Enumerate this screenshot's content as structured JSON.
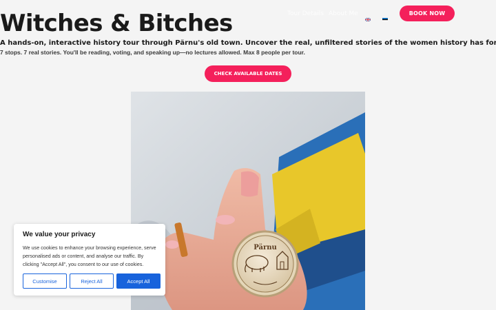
{
  "header": {
    "nav": [
      {
        "label": "Tour Details"
      },
      {
        "label": "About Me"
      }
    ],
    "languages": [
      "English",
      "Eesti"
    ],
    "book_label": "BOOK NOW"
  },
  "hero": {
    "title": "Witches & Bitches",
    "subtitle": "A hands-on, interactive history tour through Pärnu's old town. Uncover the real, unfiltered stories of the women history has forgotten.",
    "subline": "7 stops. 7 real stories. You'll be reading, voting, and speaking up—no lectures allowed. Max 8 people per tour.",
    "cta_label": "CHECK AVAILABLE DATES"
  },
  "photo": {
    "coin_text": "Pärnu"
  },
  "cookie": {
    "title": "We value your privacy",
    "body": "We use cookies to enhance your browsing experience, serve personalised ads or content, and analyse our traffic. By clicking \"Accept All\", you consent to our use of cookies.",
    "customise_label": "Customise",
    "reject_label": "Reject All",
    "accept_label": "Accept All"
  },
  "colors": {
    "accent": "#f4205b",
    "cookie_blue": "#1863dc"
  }
}
